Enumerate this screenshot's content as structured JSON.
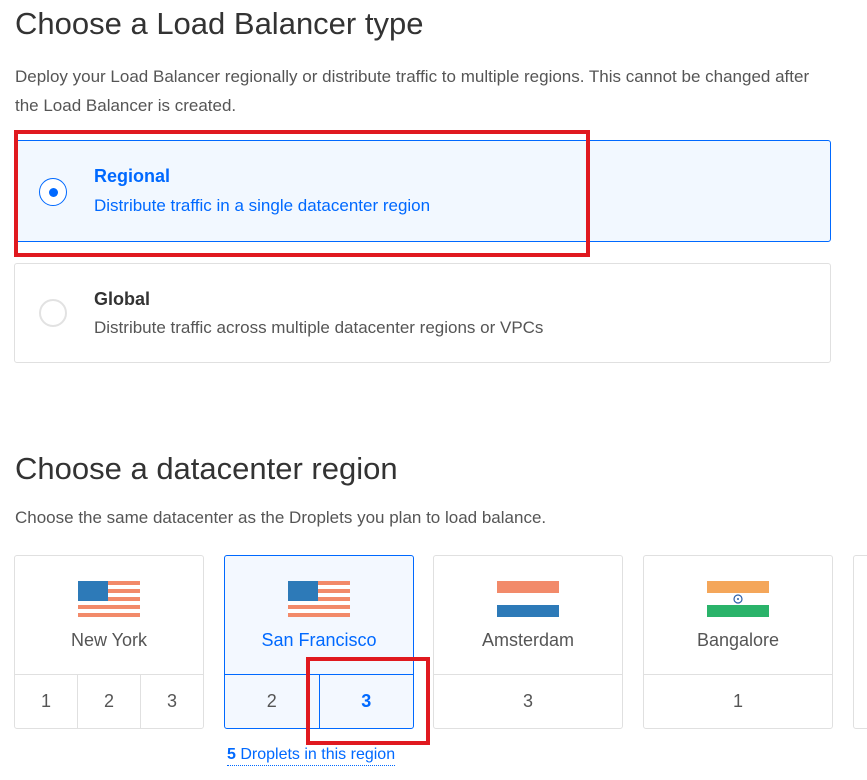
{
  "lb_type": {
    "title": "Choose a Load Balancer type",
    "description": "Deploy your Load Balancer regionally or distribute traffic to multiple regions. This cannot be changed after the Load Balancer is created.",
    "options": [
      {
        "title": "Regional",
        "subtitle": "Distribute traffic in a single datacenter region",
        "selected": true
      },
      {
        "title": "Global",
        "subtitle": "Distribute traffic across multiple datacenter regions or VPCs",
        "selected": false
      }
    ]
  },
  "region": {
    "title": "Choose a datacenter region",
    "description": "Choose the same datacenter as the Droplets you plan to load balance.",
    "datacenters": [
      {
        "name": "New York",
        "flag": "us-flag",
        "numbers": [
          "1",
          "2",
          "3"
        ],
        "selected": false
      },
      {
        "name": "San Francisco",
        "flag": "us-flag",
        "numbers": [
          "2",
          "3"
        ],
        "selected": true,
        "active_number": "3"
      },
      {
        "name": "Amsterdam",
        "flag": "nl-flag",
        "numbers": [
          "3"
        ],
        "selected": false
      },
      {
        "name": "Bangalore",
        "flag": "in-flag",
        "numbers": [
          "1"
        ],
        "selected": false
      }
    ],
    "droplets_count": "5",
    "droplets_text": " Droplets in this region"
  },
  "colors": {
    "accent": "#0069ff",
    "highlight": "#e0191f",
    "selected_bg": "#f2f8ff"
  }
}
